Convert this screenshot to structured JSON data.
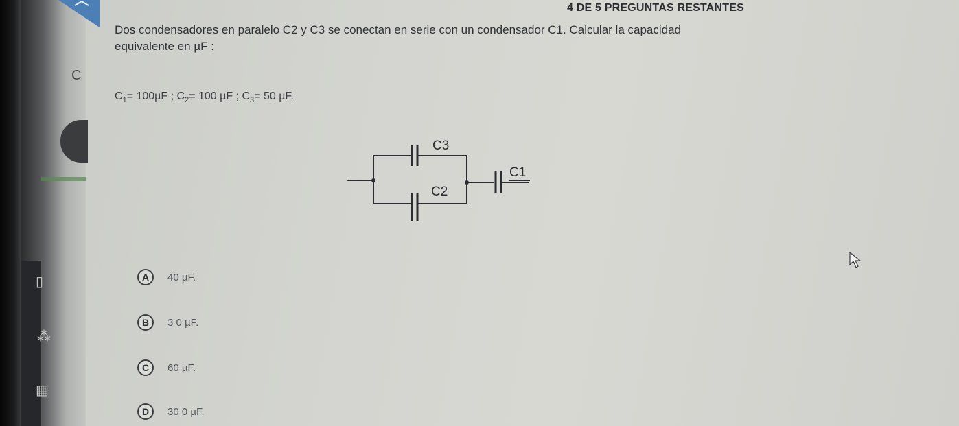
{
  "header": {
    "remaining": "4 DE 5 PREGUNTAS RESTANTES"
  },
  "sidebar": {
    "partial_letter": "C",
    "icons": [
      "book-icon",
      "group-icon",
      "calendar-icon"
    ]
  },
  "question": {
    "text": "Dos condensadores en paralelo C2 y C3 se conectan en serie con un condensador C1. Calcular la capacidad equivalente en µF :",
    "given": {
      "c1_sym": "C",
      "c1_sub": "1",
      "c1_val": "= 100µF ;",
      "c2_sym": "C",
      "c2_sub": "2",
      "c2_val": "= 100 µF ;",
      "c3_sym": "C",
      "c3_sub": "3",
      "c3_val": "= 50 µF."
    }
  },
  "circuit": {
    "c3": "C3",
    "c2": "C2",
    "c1": "C1"
  },
  "options": [
    {
      "letter": "A",
      "text": "40 µF."
    },
    {
      "letter": "B",
      "text": "3 0 µF."
    },
    {
      "letter": "C",
      "text": "60 µF."
    },
    {
      "letter": "D",
      "text": "30 0 µF."
    }
  ]
}
